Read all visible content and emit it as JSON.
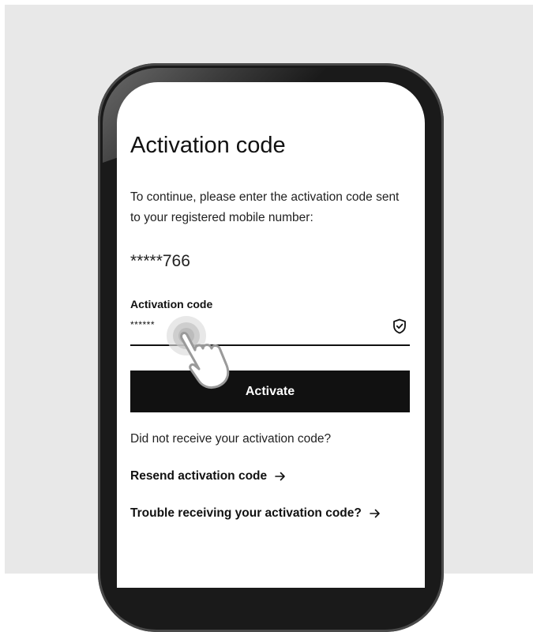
{
  "screen": {
    "title": "Activation code",
    "instructions": "To continue, please enter the activation code sent to your registered mobile number:",
    "masked_number": "*****766",
    "code_field": {
      "label": "Activation code",
      "value": "******",
      "icon": "shield-check-icon"
    },
    "activate_button": "Activate",
    "help_text": "Did not receive your activation code?",
    "links": {
      "resend": "Resend activation code",
      "trouble": "Trouble receiving your activation code?"
    }
  },
  "colors": {
    "backdrop": "#e8e8e8",
    "phone_frame": "#1a1a1a",
    "button": "#111111",
    "button_text": "#ffffff"
  }
}
